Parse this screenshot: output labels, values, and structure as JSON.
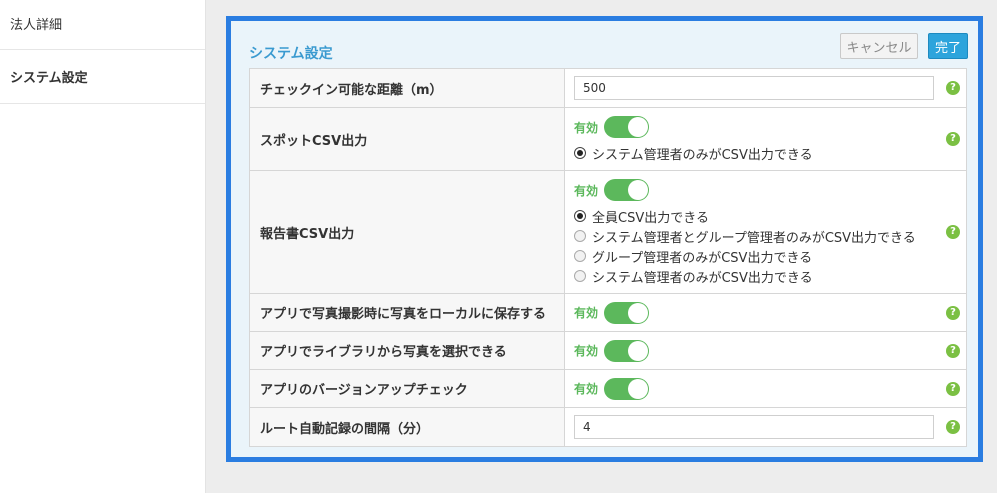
{
  "sidebar": {
    "items": [
      {
        "label": "法人詳細"
      },
      {
        "label": "システム設定"
      }
    ]
  },
  "panel": {
    "title": "システム設定",
    "cancel_label": "キャンセル",
    "done_label": "完了"
  },
  "help_symbol": "?",
  "toggle_on_label": "有効",
  "settings": {
    "checkin_distance": {
      "label": "チェックイン可能な距離（m）",
      "value": "500"
    },
    "spot_csv": {
      "label": "スポットCSV出力",
      "enabled": true,
      "options": [
        {
          "label": "システム管理者のみがCSV出力できる",
          "checked": true
        }
      ]
    },
    "report_csv": {
      "label": "報告書CSV出力",
      "enabled": true,
      "options": [
        {
          "label": "全員CSV出力できる",
          "checked": true
        },
        {
          "label": "システム管理者とグループ管理者のみがCSV出力できる",
          "checked": false
        },
        {
          "label": "グループ管理者のみがCSV出力できる",
          "checked": false
        },
        {
          "label": "システム管理者のみがCSV出力できる",
          "checked": false
        }
      ]
    },
    "save_local": {
      "label": "アプリで写真撮影時に写真をローカルに保存する",
      "enabled": true
    },
    "library_select": {
      "label": "アプリでライブラリから写真を選択できる",
      "enabled": true
    },
    "version_check": {
      "label": "アプリのバージョンアップチェック",
      "enabled": true
    },
    "route_interval": {
      "label": "ルート自動記録の間隔（分）",
      "value": "4"
    }
  },
  "colors": {
    "panel_border": "#2a7de1",
    "panel_bg": "#eaf4fa",
    "title": "#3a9ad0",
    "toggle_on": "#5cb85c",
    "primary_button": "#2da4dc",
    "help_icon": "#7bc043"
  }
}
